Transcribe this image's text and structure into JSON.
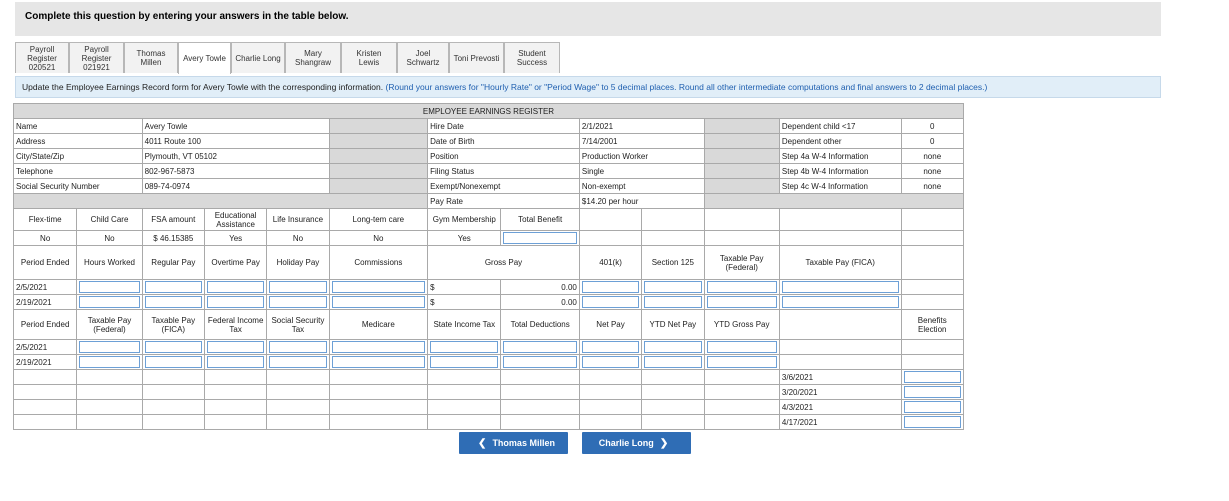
{
  "header": {
    "text": "Complete this question by entering your answers in the table below."
  },
  "tabs": [
    {
      "label": "Payroll\nRegister\n020521"
    },
    {
      "label": "Payroll\nRegister\n021921"
    },
    {
      "label": "Thomas\nMillen"
    },
    {
      "label": "Avery Towle"
    },
    {
      "label": "Charlie Long"
    },
    {
      "label": "Mary\nShangraw"
    },
    {
      "label": "Kristen\nLewis"
    },
    {
      "label": "Joel\nSchwartz"
    },
    {
      "label": "Toni Prevosti"
    },
    {
      "label": "Student\nSuccess"
    }
  ],
  "instruction": {
    "main": "Update the Employee Earnings Record form for Avery Towle with the corresponding information.",
    "note": "(Round your answers for \"Hourly Rate\" or \"Period Wage\" to 5 decimal places. Round all other intermediate computations and final answers to 2 decimal places.)"
  },
  "register": {
    "title": "EMPLOYEE EARNINGS REGISTER",
    "info_labels": [
      "Name",
      "Address",
      "City/State/Zip",
      "Telephone",
      "Social Security Number"
    ],
    "info_values": [
      "Avery Towle",
      "4011 Route 100",
      "Plymouth, VT 05102",
      "802-967-5873",
      "089-74-0974"
    ],
    "mid_labels": [
      "Hire Date",
      "Date of Birth",
      "Position",
      "Filing Status",
      "Exempt/Nonexempt",
      "Pay Rate"
    ],
    "mid_values": [
      "2/1/2021",
      "7/14/2001",
      "Production Worker",
      "Single",
      "Non-exempt",
      "$14.20 per hour"
    ],
    "right_labels": [
      "Dependent child <17",
      "Dependent other",
      "Step 4a W-4 Information",
      "Step 4b W-4 Information",
      "Step 4c W-4 Information"
    ],
    "right_values": [
      "0",
      "0",
      "none",
      "none",
      "none"
    ],
    "benefit_headers": [
      "Flex-time",
      "Child Care",
      "FSA amount",
      "Educational Assistance",
      "Life Insurance",
      "Long-tem care",
      "Gym Membership",
      "Total Benefit"
    ],
    "benefit_values": [
      "No",
      "No",
      "$  46.15385",
      "Yes",
      "No",
      "No",
      "Yes"
    ],
    "pay_headers": [
      "Period Ended",
      "Hours Worked",
      "Regular Pay",
      "Overtime Pay",
      "Holiday Pay",
      "Commissions",
      "Gross Pay",
      "401(k)",
      "Section 125",
      "Taxable Pay (Federal)",
      "Taxable Pay (FICA)"
    ],
    "pay_rows": [
      {
        "period": "2/5/2021",
        "dollar": "$",
        "gross": "0.00"
      },
      {
        "period": "2/19/2021",
        "dollar": "$",
        "gross": "0.00"
      }
    ],
    "tax_headers": [
      "Period Ended",
      "Taxable Pay (Federal)",
      "Taxable Pay (FICA)",
      "Federal Income Tax",
      "Social Security Tax",
      "Medicare",
      "State Income Tax",
      "Total Deductions",
      "Net Pay",
      "YTD Net Pay",
      "YTD Gross Pay",
      "",
      "Benefits Election"
    ],
    "tax_rows": [
      {
        "period": "2/5/2021"
      },
      {
        "period": "2/19/2021"
      }
    ],
    "benefit_dates": [
      "3/6/2021",
      "3/20/2021",
      "4/3/2021",
      "4/17/2021"
    ]
  },
  "nav": {
    "prev_label": "Thomas Millen",
    "next_label": "Charlie Long"
  }
}
